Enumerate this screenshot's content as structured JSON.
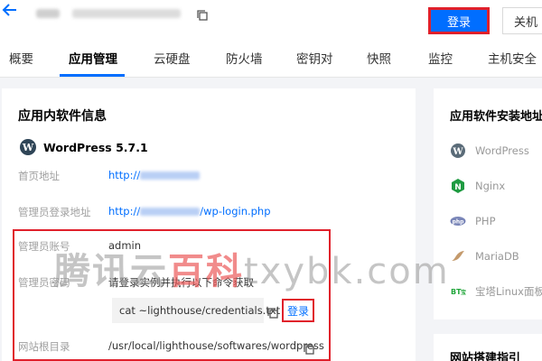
{
  "header": {
    "back_icon": "arrow-left-icon",
    "login_button": "登录",
    "shutdown_button": "关机"
  },
  "tabs": [
    {
      "label": "概要"
    },
    {
      "label": "应用管理"
    },
    {
      "label": "云硬盘"
    },
    {
      "label": "防火墙"
    },
    {
      "label": "密钥对"
    },
    {
      "label": "快照"
    },
    {
      "label": "监控"
    },
    {
      "label": "主机安全"
    }
  ],
  "app_info": {
    "title": "应用内软件信息",
    "app_name": "WordPress 5.7.1",
    "rows": {
      "homepage_label": "首页地址",
      "homepage_prefix": "http://",
      "admin_url_label": "管理员登录地址",
      "admin_url_prefix": "http://",
      "admin_url_suffix": "/wp-login.php",
      "admin_account_label": "管理员账号",
      "admin_account_value": "admin",
      "admin_password_label": "管理员密码",
      "admin_password_hint": "请登录实例并执行以下命令获取",
      "command": "cat ~lighthouse/credentials.txt",
      "inline_login": "登录",
      "webroot_label": "网站根目录",
      "webroot_value": "/usr/local/lighthouse/softwares/wordpress"
    }
  },
  "install_dirs": {
    "title": "应用软件安装地址",
    "items": [
      {
        "name": "WordPress",
        "icon": "wordpress-icon"
      },
      {
        "name": "Nginx",
        "icon": "nginx-icon"
      },
      {
        "name": "PHP",
        "icon": "php-icon"
      },
      {
        "name": "MariaDB",
        "icon": "mariadb-icon"
      },
      {
        "name": "宝塔Linux面板",
        "icon": "bt-panel-icon"
      }
    ]
  },
  "guide": {
    "title": "网站搭建指引"
  },
  "watermark": {
    "part1": "腾讯云",
    "part2": "百科",
    "part3": "txybk.com"
  },
  "colors": {
    "accent": "#006eff",
    "highlight_border": "#e0202b"
  }
}
